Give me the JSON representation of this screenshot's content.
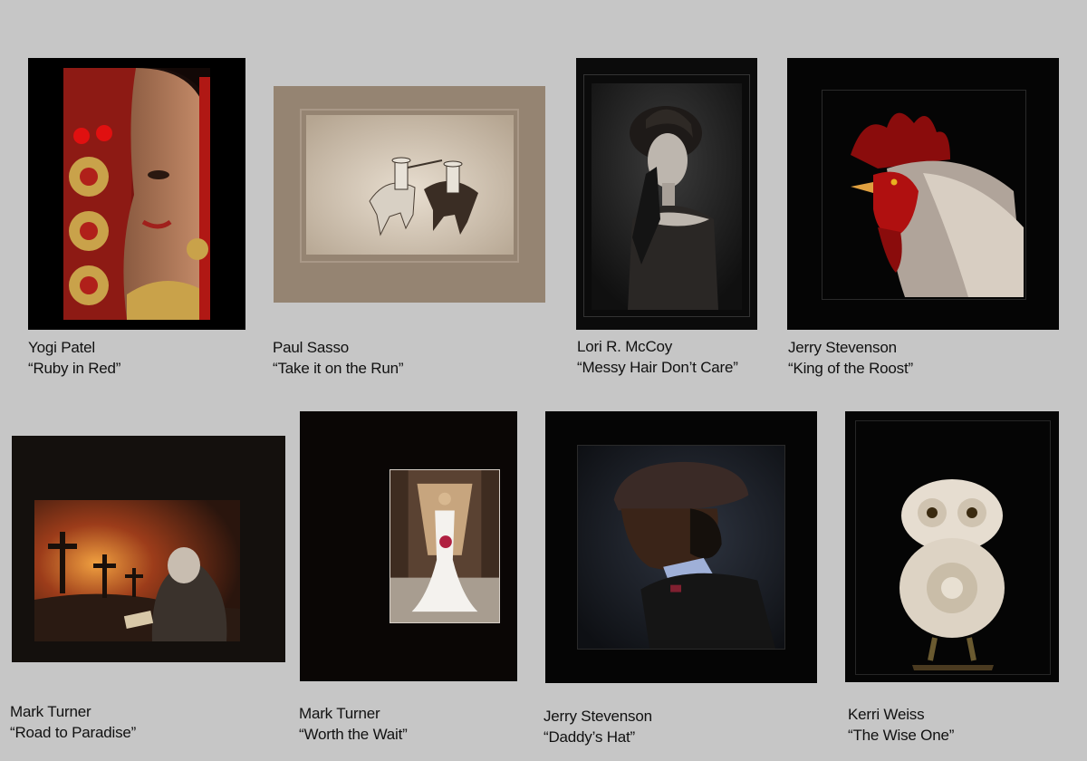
{
  "gallery": {
    "background_color": "#c6c6c6",
    "entries": [
      {
        "artist": "Yogi Patel",
        "title": "“Ruby in Red”"
      },
      {
        "artist": "Paul Sasso",
        "title": "“Take it on the Run”"
      },
      {
        "artist": "Lori R. McCoy",
        "title": "“Messy Hair Don’t Care”"
      },
      {
        "artist": "Jerry Stevenson",
        "title": "“King of the Roost”"
      },
      {
        "artist": "Mark Turner",
        "title": "“Road to Paradise”"
      },
      {
        "artist": "Mark Turner",
        "title": "“Worth the Wait”"
      },
      {
        "artist": "Jerry Stevenson",
        "title": "“Daddy’s Hat”"
      },
      {
        "artist": "Kerri Weiss",
        "title": "“The Wise One”"
      }
    ]
  }
}
